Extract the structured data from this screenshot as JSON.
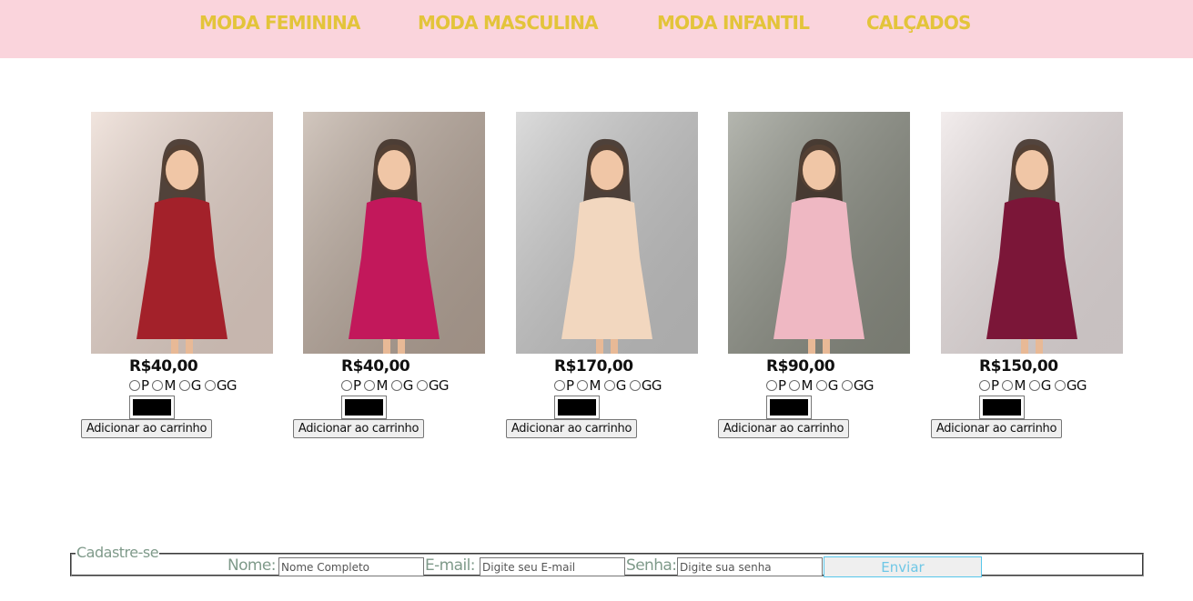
{
  "nav": {
    "items": [
      {
        "label": "MODA FEMININA"
      },
      {
        "label": "MODA MASCULINA"
      },
      {
        "label": "MODA INFANTIL"
      },
      {
        "label": "CALÇADOS"
      }
    ]
  },
  "products": [
    {
      "price": "R$40,00",
      "image": "red-floral-blouse-photo",
      "dress": "#a3212a",
      "bg": "#e9d6cc"
    },
    {
      "price": "R$40,00",
      "image": "pink-skirt-outfit-photo",
      "dress": "#c2185b",
      "bg": "#b9a89b"
    },
    {
      "price": "R$170,00",
      "image": "cream-gown-photo",
      "dress": "#f2d7bf",
      "bg": "#c9c9c9"
    },
    {
      "price": "R$90,00",
      "image": "pink-dress-photo",
      "dress": "#efb8c3",
      "bg": "#8c8f84"
    },
    {
      "price": "R$150,00",
      "image": "burgundy-dress-photo",
      "dress": "#7b1638",
      "bg": "#ece3e3"
    }
  ],
  "sizes": [
    "P",
    "M",
    "G",
    "GG"
  ],
  "add_to_cart_label": "Adicionar ao carrinho",
  "signup": {
    "legend": "Cadastre-se",
    "name_label": "Nome:",
    "name_placeholder": "Nome Completo",
    "email_label": "E-mail:",
    "email_placeholder": "Digite seu E-mail",
    "password_label": "Senha:",
    "password_placeholder": "Digite sua senha",
    "submit_label": "Enviar"
  },
  "colors": {
    "nav_background": "#fad4dc",
    "nav_text": "#e3c43a",
    "form_label": "#7f9a8a",
    "submit_text": "#6ec7e6"
  }
}
